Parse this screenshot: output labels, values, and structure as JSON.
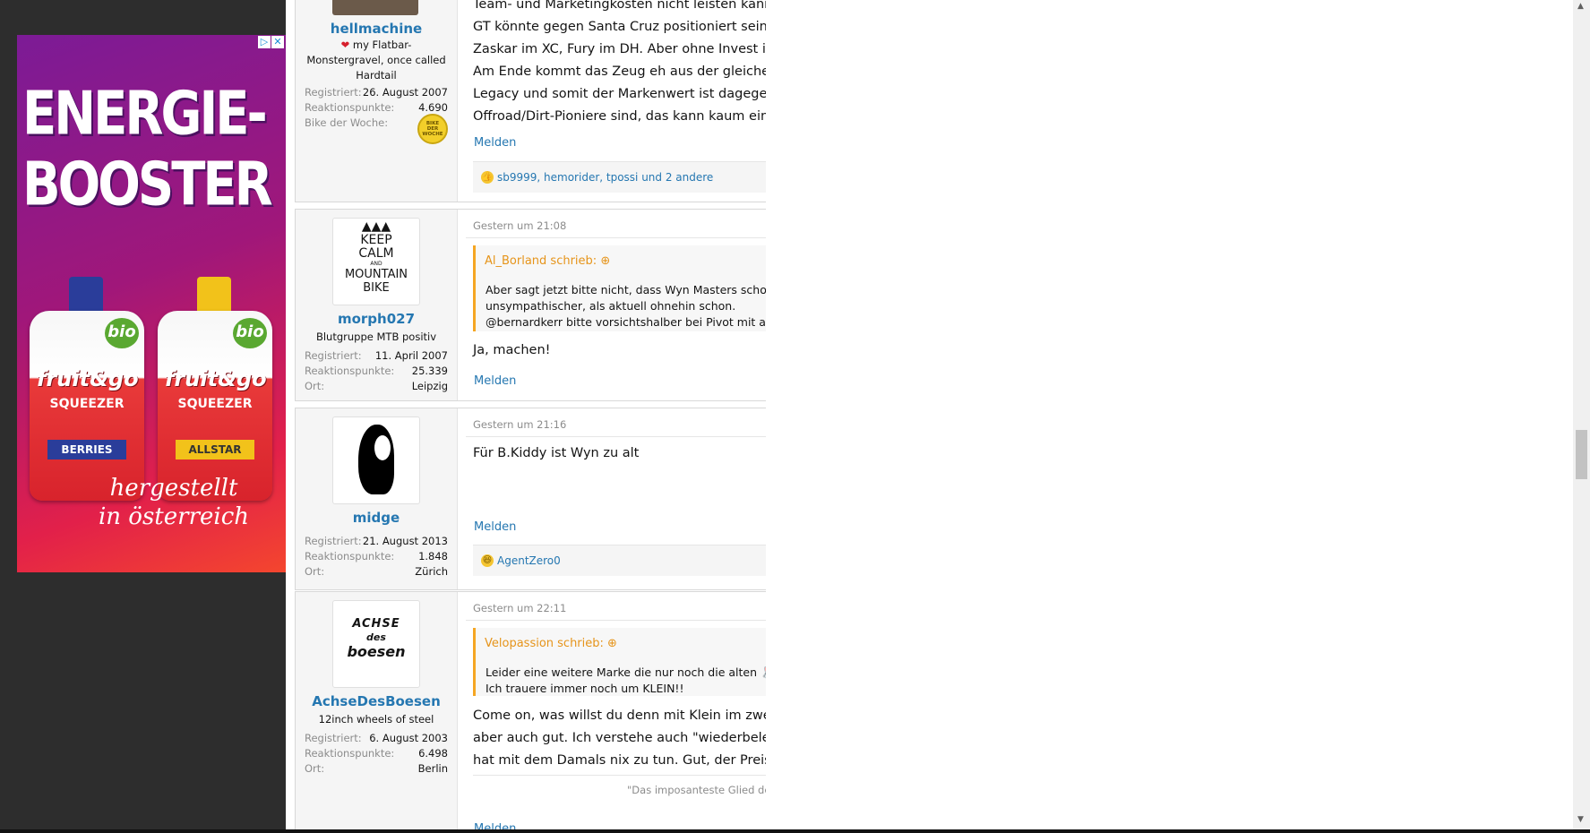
{
  "ad": {
    "adchoices_icon": "adchoices-icon",
    "close_icon": "close-icon",
    "headline_line1": "ENERGIE-",
    "headline_line2": "BOOSTER",
    "pouch_left": {
      "bio": "bio",
      "brand": "fruit&go",
      "sub": "SQUEEZER",
      "variant": "BERRIES"
    },
    "pouch_right": {
      "bio": "bio",
      "brand": "fruit&go",
      "sub": "SQUEEZER",
      "variant": "ALLSTAR"
    },
    "tagline_line1": "hergestellt",
    "tagline_line2": "in österreich"
  },
  "posts": [
    {
      "username": "hellmachine",
      "user_title_line1": "my Flatbar-",
      "user_title_line2": "Monstergravel, once called",
      "user_title_line3": "Hardtail",
      "registered_label": "Registriert:",
      "registered": "26. August 2007",
      "points_label": "Reaktionspunkte:",
      "points": "4.690",
      "extra_label": "Bike der Woche:",
      "extra_badge": "BIKE DER WOCHE",
      "lines": [
        "Team- und Marketingkosten nicht leisten kann,",
        "GT könnte gegen Santa Cruz positioniert sein, wenn",
        "Zaskar im XC, Fury im DH. Aber ohne Invest in Mark",
        "Am Ende kommt das Zeug eh aus der gleichen Ferr",
        "Legacy und somit der Markenwert ist dagegen ziem",
        "Offroad/Dirt-Pioniere sind, das kann kaum eine anc"
      ],
      "report": "Melden",
      "reactions": "sb9999, hemorider, tpossi und 2 andere"
    },
    {
      "username": "morph027",
      "avatar_text": [
        "KEEP",
        "CALM",
        "AND",
        "MOUNTAIN",
        "BIKE"
      ],
      "user_title": "Blutgruppe MTB positiv",
      "registered_label": "Registriert:",
      "registered": "11. April 2007",
      "points_label": "Reaktionspunkte:",
      "points": "25.339",
      "location_label": "Ort:",
      "location": "Leipzig",
      "date": "Gestern um 21:08",
      "quote_author": "Al_Borland schrieb:",
      "quote_lines": [
        "Aber sagt jetzt bitte nicht, dass Wyn Masters schon in R",
        "unsympathischer, als aktuell ohnehin schon.",
        "@bernardkerr bitte vorsichtshalber bei Pivot mit aufneh"
      ],
      "body": "Ja, machen!",
      "report": "Melden"
    },
    {
      "username": "midge",
      "registered_label": "Registriert:",
      "registered": "21. August 2013",
      "points_label": "Reaktionspunkte:",
      "points": "1.848",
      "location_label": "Ort:",
      "location": "Zürich",
      "date": "Gestern um 21:16",
      "body": "Für B.Kiddy ist Wyn zu alt",
      "report": "Melden",
      "reactions": "AgentZero0"
    },
    {
      "username": "AchseDesBoesen",
      "avatar_text": [
        "ACHSE",
        "des",
        "boesen"
      ],
      "user_title": "12inch wheels of steel",
      "registered_label": "Registriert:",
      "registered": "6. August 2003",
      "points_label": "Reaktionspunkte:",
      "points": "6.498",
      "location_label": "Ort:",
      "location": "Berlin",
      "date": "Gestern um 22:11",
      "quote_author": "Velopassion schrieb:",
      "quote_lines": [
        "Leider eine weitere Marke die nur noch die alten 🐰 be",
        "Ich trauere immer noch um KLEIN!!"
      ],
      "lines": [
        "Come on, was willst du denn mit Klein im zweiten J",
        "aber auch gut. Ich verstehe auch \"wiederbelebte\" M",
        "hat mit dem Damals nix zu tun. Gut, der Preispunkt"
      ],
      "signature": "\"Das imposanteste Glied des de",
      "report": "Melden"
    }
  ],
  "colors": {
    "link": "#2577b1",
    "quote_accent": "#f5a623",
    "muted": "#8c8c8c"
  }
}
